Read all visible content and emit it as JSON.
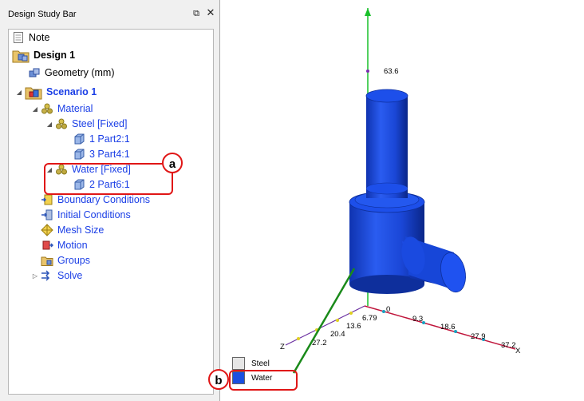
{
  "panel": {
    "title": "Design Study Bar",
    "pin_glyph": "⧉",
    "close_glyph": "✕"
  },
  "tree": {
    "items": [
      {
        "label": "Note",
        "icon": "note-icon"
      },
      {
        "label": "Design 1",
        "icon": "design-icon"
      },
      {
        "label": "Geometry (mm)",
        "icon": "geometry-icon"
      },
      {
        "label": "Scenario 1",
        "icon": "scenario-icon"
      },
      {
        "label": "Material",
        "icon": "material-icon"
      },
      {
        "label": "Steel [Fixed]",
        "icon": "material-icon"
      },
      {
        "label": "1 Part2:1",
        "icon": "part-icon"
      },
      {
        "label": "3 Part4:1",
        "icon": "part-icon"
      },
      {
        "label": "Water [Fixed]",
        "icon": "material-icon"
      },
      {
        "label": "2 Part6:1",
        "icon": "part-icon"
      },
      {
        "label": "Boundary Conditions",
        "icon": "boundary-conditions-icon"
      },
      {
        "label": "Initial Conditions",
        "icon": "initial-conditions-icon"
      },
      {
        "label": "Mesh Size",
        "icon": "mesh-size-icon"
      },
      {
        "label": "Motion",
        "icon": "motion-icon"
      },
      {
        "label": "Groups",
        "icon": "groups-icon"
      },
      {
        "label": "Solve",
        "icon": "solve-icon"
      }
    ],
    "expander_open": "◢",
    "expander_closed": "▷"
  },
  "callouts": {
    "a": "a",
    "b": "b"
  },
  "legend": {
    "items": [
      {
        "label": "Steel",
        "color": "#e6e6e6"
      },
      {
        "label": "Water",
        "color": "#1a4fe0"
      }
    ]
  },
  "axes": {
    "y_label": "63.6",
    "x_ticks": [
      "0",
      "9.3",
      "18.6",
      "27.9",
      "37.2"
    ],
    "x_name": "X",
    "z_ticks": [
      "6.79",
      "13.6",
      "20.4",
      "27.2"
    ],
    "z_name": "Z"
  },
  "colors": {
    "model_blue": "#1a4fe0",
    "model_dark": "#0f2fa8",
    "x_axis": "#c0163c",
    "y_axis": "#19c02a",
    "z_axis": "#6a2fa0",
    "callout_red": "#e01616",
    "leader_green": "#1a8a1a"
  }
}
